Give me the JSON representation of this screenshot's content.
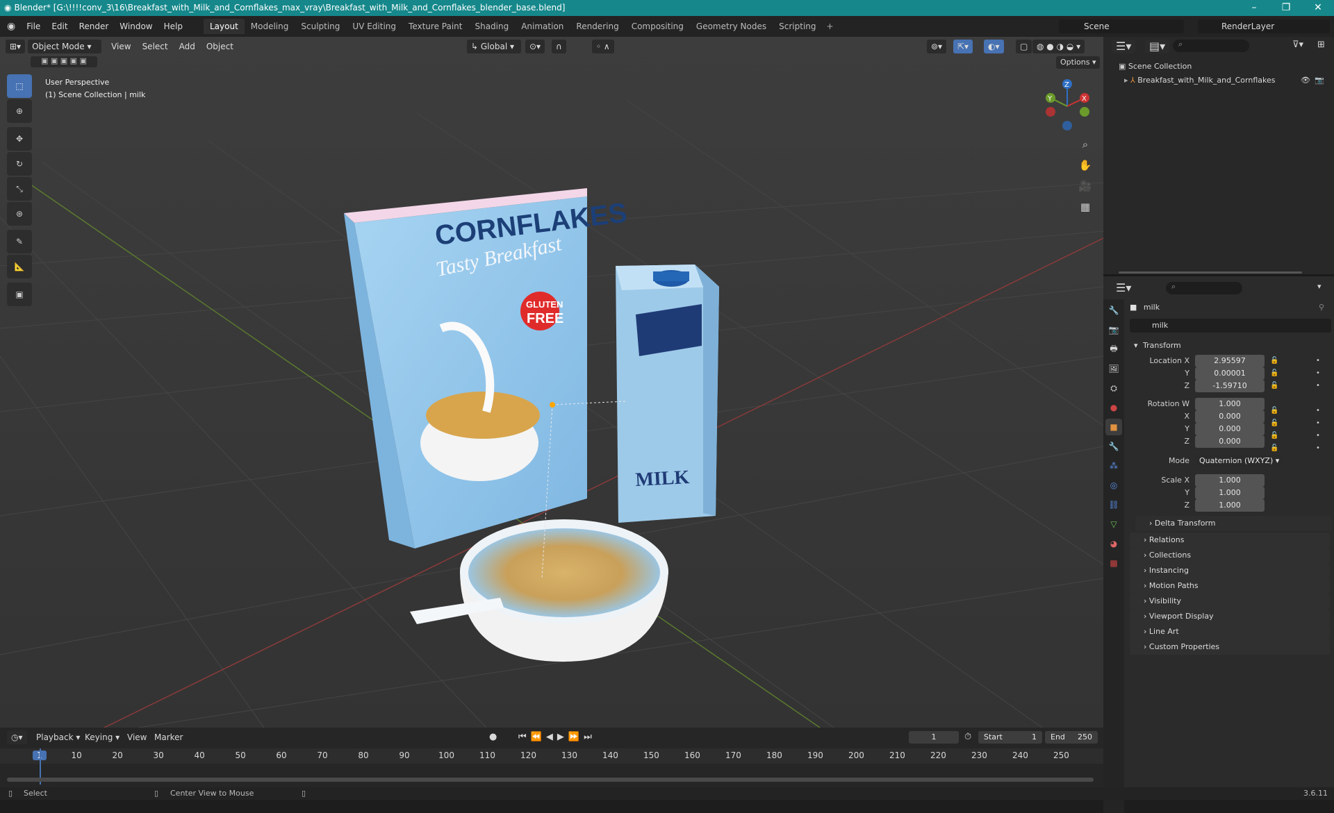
{
  "title": "Blender* [G:\\!!!!conv_3\\16\\Breakfast_with_Milk_and_Cornflakes_max_vray\\Breakfast_with_Milk_and_Cornflakes_blender_base.blend]",
  "menus": [
    "File",
    "Edit",
    "Render",
    "Window",
    "Help"
  ],
  "workspaces": [
    "Layout",
    "Modeling",
    "Sculpting",
    "UV Editing",
    "Texture Paint",
    "Shading",
    "Animation",
    "Rendering",
    "Compositing",
    "Geometry Nodes",
    "Scripting"
  ],
  "active_workspace": "Layout",
  "scene": "Scene",
  "render_layer": "RenderLayer",
  "viewport": {
    "mode": "Object Mode",
    "menus": [
      "View",
      "Select",
      "Add",
      "Object"
    ],
    "orientation": "Global",
    "options": "Options",
    "overlay_line1": "User Perspective",
    "overlay_line2": "(1) Scene Collection | milk",
    "gizmo_axes": {
      "x": "X",
      "y": "Y",
      "z": "Z"
    },
    "scene_text": {
      "box_title": "CORNFLAKES",
      "box_sub": "Tasty Breakfast",
      "badge1": "GLUTEN",
      "badge2": "FREE",
      "carton": "MILK"
    }
  },
  "outliner": {
    "root": "Scene Collection",
    "items": [
      {
        "label": "Breakfast_with_Milk_and_Cornflakes"
      }
    ]
  },
  "properties": {
    "object_name": "milk",
    "data_name": "milk",
    "transform_label": "Transform",
    "location": {
      "x": "2.95597",
      "y": "0.00001",
      "z": "-1.59710"
    },
    "rotation": {
      "w": "1.000",
      "x": "0.000",
      "y": "0.000",
      "z": "0.000"
    },
    "mode_label": "Mode",
    "mode_value": "Quaternion (WXYZ)",
    "scale": {
      "x": "1.000",
      "y": "1.000",
      "z": "1.000"
    },
    "labels": {
      "location_x": "Location X",
      "rotation_w": "Rotation W",
      "scale_x": "Scale X",
      "x": "X",
      "y": "Y",
      "z": "Z"
    },
    "delta": "Delta Transform",
    "panels": [
      "Relations",
      "Collections",
      "Instancing",
      "Motion Paths",
      "Visibility",
      "Viewport Display",
      "Line Art",
      "Custom Properties"
    ]
  },
  "timeline": {
    "menus": [
      "Playback",
      "Keying",
      "View",
      "Marker"
    ],
    "current_frame": "1",
    "start_label": "Start",
    "start": "1",
    "end_label": "End",
    "end": "250",
    "ticks": [
      "1",
      "10",
      "20",
      "30",
      "40",
      "50",
      "60",
      "70",
      "80",
      "90",
      "100",
      "110",
      "120",
      "130",
      "140",
      "150",
      "160",
      "170",
      "180",
      "190",
      "200",
      "210",
      "220",
      "230",
      "240",
      "250"
    ]
  },
  "status": {
    "select": "Select",
    "center": "Center View to Mouse",
    "version": "3.6.11"
  },
  "colors": {
    "accent": "#4772b3",
    "titlebar": "#16888b",
    "box": "#8fc3e8",
    "carton": "#a9d3f2"
  }
}
